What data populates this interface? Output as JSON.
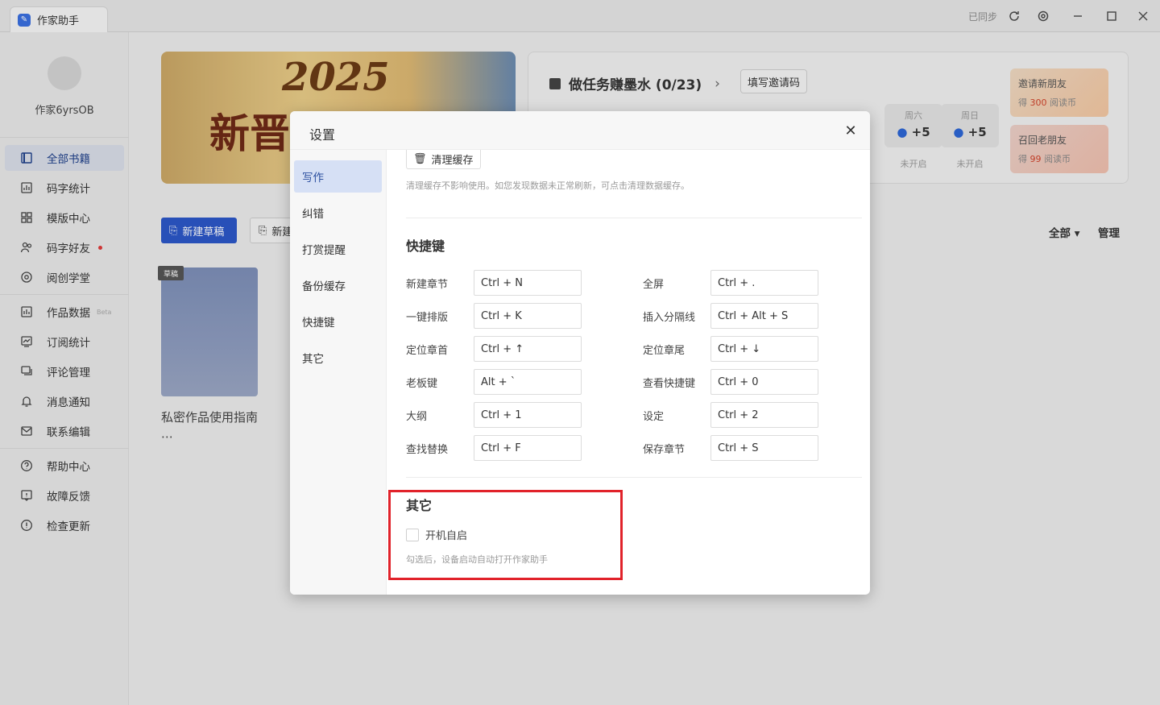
{
  "titlebar": {
    "app_name": "作家助手",
    "sync_status": "已同步"
  },
  "sidebar": {
    "username": "作家6yrsOB",
    "items": [
      {
        "label": "全部书籍",
        "icon": "books-icon"
      },
      {
        "label": "码字统计",
        "icon": "chart-icon"
      },
      {
        "label": "模版中心",
        "icon": "grid-icon"
      },
      {
        "label": "码字好友",
        "icon": "friends-icon"
      },
      {
        "label": "阅创学堂",
        "icon": "gear-flower-icon"
      },
      {
        "label": "作品数据",
        "icon": "bar-chart-icon",
        "badge": "Beta"
      },
      {
        "label": "订阅统计",
        "icon": "trend-icon"
      },
      {
        "label": "评论管理",
        "icon": "comment-icon"
      },
      {
        "label": "消息通知",
        "icon": "bell-icon"
      },
      {
        "label": "联系编辑",
        "icon": "mail-icon"
      },
      {
        "label": "帮助中心",
        "icon": "help-icon"
      },
      {
        "label": "故障反馈",
        "icon": "feedback-icon"
      },
      {
        "label": "检查更新",
        "icon": "update-icon"
      }
    ]
  },
  "banner": {
    "year": "2025",
    "text": "新晋"
  },
  "tasks": {
    "title": "做任务赚墨水 (0/23)",
    "invite_button": "填写邀请码",
    "days": [
      {
        "name": "周六",
        "points": "+5",
        "status": "未开启"
      },
      {
        "name": "周日",
        "points": "+5",
        "status": "未开启"
      }
    ],
    "promos": [
      {
        "title": "邀请新朋友",
        "prefix": "得",
        "num": "300",
        "suffix": "阅读币"
      },
      {
        "title": "召回老朋友",
        "prefix": "得",
        "num": "99",
        "suffix": "阅读币"
      }
    ]
  },
  "main": {
    "new_draft": "新建草稿",
    "new_draft2": "新建",
    "filter_all": "全部",
    "manage": "管理",
    "book_tag": "草稿",
    "book_title": "私密作品使用指南"
  },
  "modal": {
    "title": "设置",
    "nav": [
      "写作",
      "纠错",
      "打赏提醒",
      "备份缓存",
      "快捷键",
      "其它"
    ],
    "cache_button": "清理缓存",
    "cache_note": "清理缓存不影响使用。如您发现数据未正常刷新，可点击清理数据缓存。",
    "shortcuts_title": "快捷键",
    "shortcuts_left": [
      {
        "label": "新建章节",
        "key": "Ctrl + N"
      },
      {
        "label": "一键排版",
        "key": "Ctrl + K"
      },
      {
        "label": "定位章首",
        "key": "Ctrl + ↑"
      },
      {
        "label": "老板键",
        "key": "Alt + `"
      },
      {
        "label": "大纲",
        "key": "Ctrl + 1"
      },
      {
        "label": "查找替换",
        "key": "Ctrl + F"
      }
    ],
    "shortcuts_right": [
      {
        "label": "全屏",
        "key": "Ctrl + ."
      },
      {
        "label": "插入分隔线",
        "key": "Ctrl + Alt + S"
      },
      {
        "label": "定位章尾",
        "key": "Ctrl + ↓"
      },
      {
        "label": "查看快捷键",
        "key": "Ctrl + 0"
      },
      {
        "label": "设定",
        "key": "Ctrl + 2"
      },
      {
        "label": "保存章节",
        "key": "Ctrl + S"
      }
    ],
    "other_title": "其它",
    "autostart_label": "开机自启",
    "autostart_checked": false,
    "autostart_note": "勾选后，设备启动自动打开作家助手"
  },
  "colors": {
    "accent": "#2c57c8",
    "highlight": "#e1222a"
  }
}
